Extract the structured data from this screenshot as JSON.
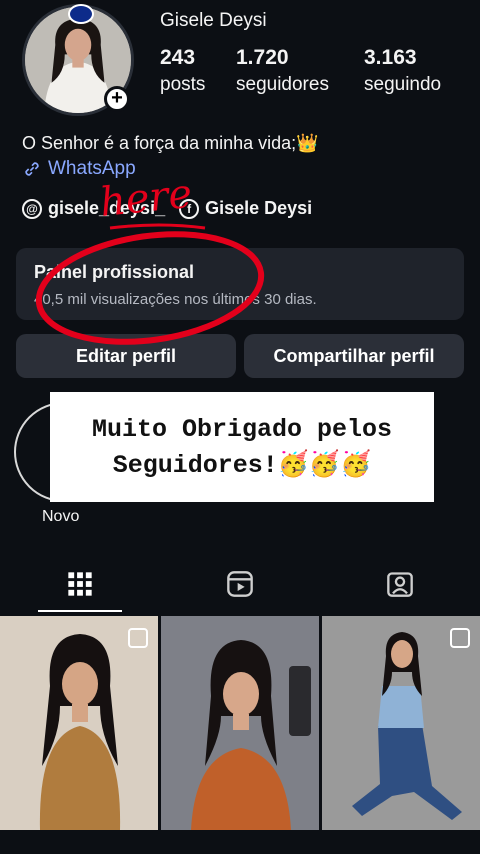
{
  "profile": {
    "username": "Gisele Deysi",
    "stats": {
      "posts_count": "243",
      "posts_label": "posts",
      "followers_count": "1.720",
      "followers_label": "seguidores",
      "following_count": "3.163",
      "following_label": "seguindo"
    },
    "bio": "O Senhor é a força da minha vida;👑",
    "link_label": "WhatsApp",
    "threads_handle": "gisele_deysi_",
    "facebook_name": "Gisele Deysi"
  },
  "professional_panel": {
    "title": "Painel profissional",
    "subtitle": "40,5 mil visualizações nos últimos 30 dias."
  },
  "buttons": {
    "edit_label": "Editar perfil",
    "share_label": "Compartilhar perfil"
  },
  "highlights": {
    "new_label": "Novo"
  },
  "overlay": {
    "line1": "Muito Obrigado pelos",
    "line2": "Seguidores!🥳🥳🥳"
  },
  "annotation": {
    "text": "here",
    "color": "#e3001b"
  },
  "tabs": [
    {
      "name": "posts-grid",
      "icon": "grid-icon",
      "active": true
    },
    {
      "name": "reels",
      "icon": "reels-icon",
      "active": false
    },
    {
      "name": "tagged",
      "icon": "tagged-icon",
      "active": false
    }
  ],
  "colors": {
    "background": "#0c0f14",
    "panel": "#1f232b",
    "button": "#2b2f38",
    "link": "#8aa8ff"
  }
}
